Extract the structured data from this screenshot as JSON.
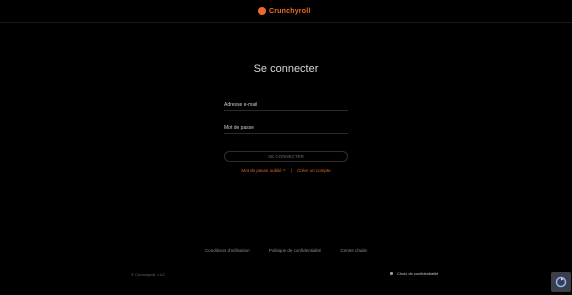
{
  "header": {
    "brand_name": "Crunchyroll",
    "brand_color": "#f06a28"
  },
  "form": {
    "title": "Se connecter",
    "email_label": "Adresse e-mail",
    "password_label": "Mot de passe",
    "submit_label": "SE CONNECTER",
    "forgot_password_link": "Mot de passe oublié ?",
    "separator": "|",
    "create_account_link": "Créer un compte"
  },
  "footer": {
    "links": [
      "Conditions d'utilisation",
      "Politique de confidentialité",
      "Centre d'aide"
    ],
    "copyright": "© Crunchyroll, LLC",
    "privacy_choices": "Choix de confidentialité"
  },
  "widgets": {
    "recaptcha_icon": "recaptcha-icon"
  }
}
